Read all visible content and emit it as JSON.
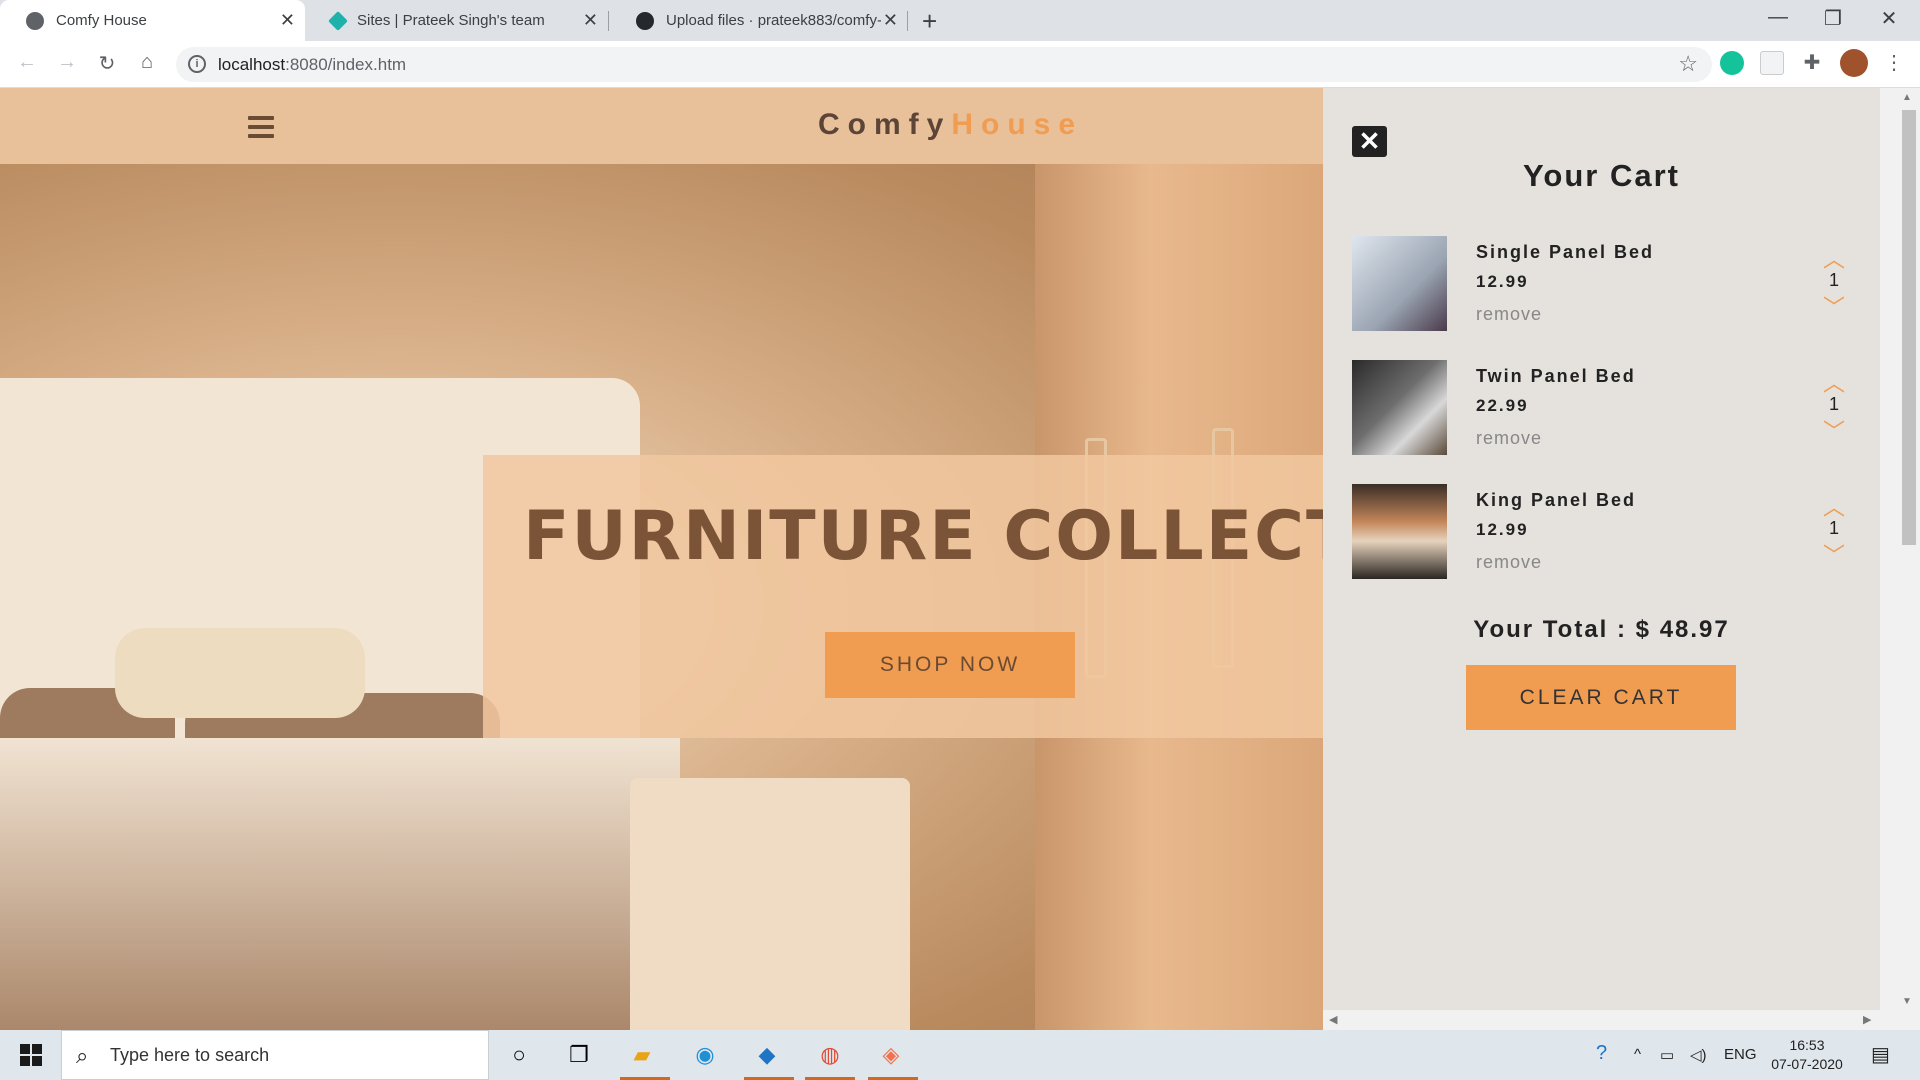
{
  "browser": {
    "tabs": [
      {
        "title": "Comfy House",
        "active": true
      },
      {
        "title": "Sites | Prateek Singh's team",
        "active": false
      },
      {
        "title": "Upload files · prateek883/comfy-",
        "active": false
      }
    ],
    "url_host": "localhost",
    "url_rest": ":8080/index.htm"
  },
  "page": {
    "logo_main": "Comfy",
    "logo_accent": "House",
    "banner_title": "FURNITURE COLLECTION",
    "shop_button": "SHOP NOW"
  },
  "cart": {
    "title": "Your Cart",
    "items": [
      {
        "name": "Single Panel Bed",
        "price": "12.99",
        "remove": "remove",
        "qty": "1"
      },
      {
        "name": "Twin Panel Bed",
        "price": "22.99",
        "remove": "remove",
        "qty": "1"
      },
      {
        "name": "King Panel Bed",
        "price": "12.99",
        "remove": "remove",
        "qty": "1"
      }
    ],
    "total_label": "Your Total : $ ",
    "total_value": "48.97",
    "clear_button": "CLEAR CART"
  },
  "taskbar": {
    "search_placeholder": "Type here to search",
    "lang": "ENG",
    "time": "16:53",
    "date": "07-07-2020"
  },
  "colors": {
    "accent": "#f09d51",
    "navbar": "#e8c09a",
    "cart_bg": "#e5e1dd"
  }
}
